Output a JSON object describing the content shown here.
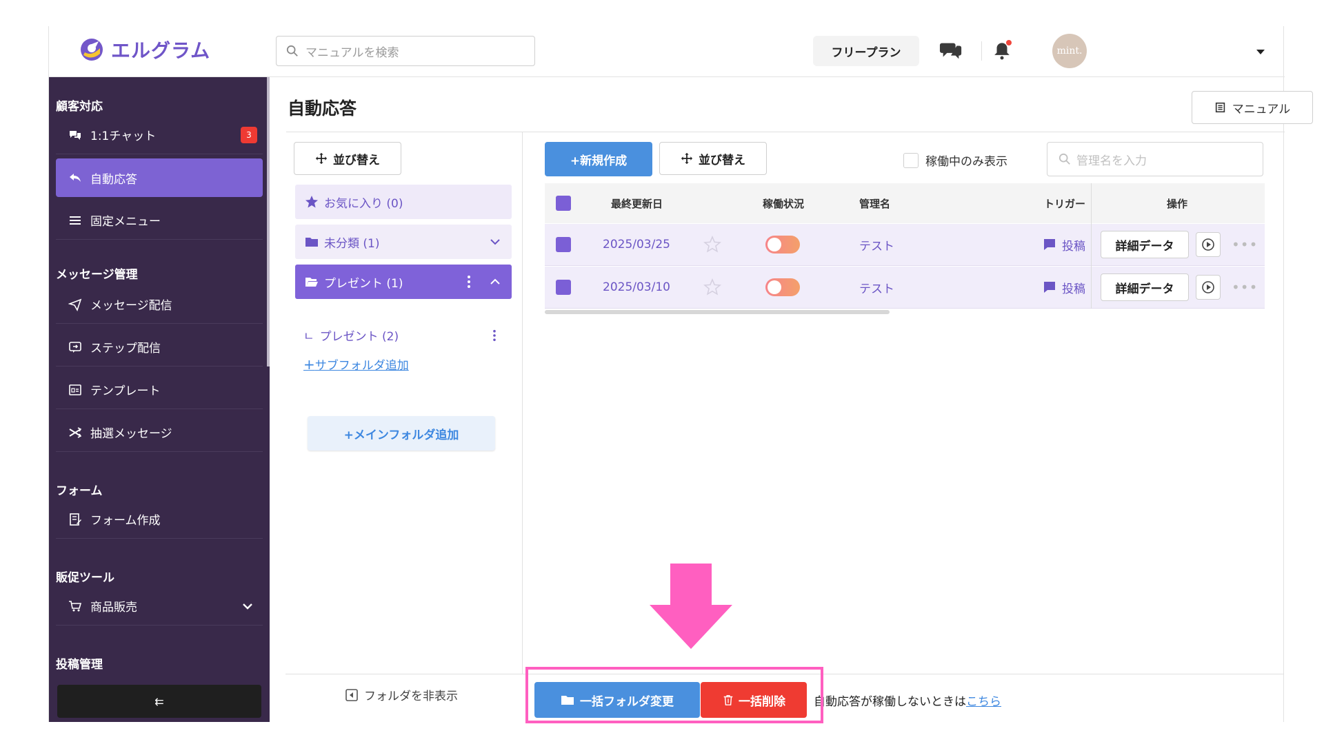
{
  "header": {
    "logo_text": "エルグラム",
    "search_placeholder": "マニュアルを検索",
    "plan_label": "フリープラン",
    "avatar_text": "mint."
  },
  "sidebar": {
    "sections": [
      {
        "title": "顧客対応",
        "items": [
          {
            "label": "1:1チャット",
            "icon": "chat-icon",
            "badge": "3"
          },
          {
            "label": "自動応答",
            "icon": "reply-icon",
            "active": true
          },
          {
            "label": "固定メニュー",
            "icon": "menu-icon"
          }
        ]
      },
      {
        "title": "メッセージ管理",
        "items": [
          {
            "label": "メッセージ配信",
            "icon": "send-icon"
          },
          {
            "label": "ステップ配信",
            "icon": "step-icon"
          },
          {
            "label": "テンプレート",
            "icon": "template-icon"
          },
          {
            "label": "抽選メッセージ",
            "icon": "shuffle-icon"
          }
        ]
      },
      {
        "title": "フォーム",
        "items": [
          {
            "label": "フォーム作成",
            "icon": "form-icon"
          }
        ]
      },
      {
        "title": "販促ツール",
        "items": [
          {
            "label": "商品販売",
            "icon": "cart-icon"
          }
        ]
      },
      {
        "title": "投稿管理",
        "items": []
      }
    ],
    "collapse_label": "⇇"
  },
  "main": {
    "title": "自動応答",
    "manual_label": "マニュアル",
    "folder_sort_label": "並び替え",
    "folders": {
      "favorite": "お気に入り (0)",
      "uncategorized": "未分類 (1)",
      "selected": "プレゼント (1)",
      "sub": "プレゼント (2)",
      "add_sub": "サブフォルダ追加",
      "add_main": "+メインフォルダ追加"
    },
    "new_label": "+新規作成",
    "list_sort_label": "並び替え",
    "active_only_label": "稼働中のみ表示",
    "name_search_placeholder": "管理名を入力",
    "table": {
      "headers": {
        "updated": "最終更新日",
        "status": "稼働状況",
        "name": "管理名",
        "trigger": "トリガー",
        "actions": "操作"
      },
      "rows": [
        {
          "date": "2025/03/25",
          "name": "テスト",
          "trigger": "投稿",
          "detail": "詳細データ"
        },
        {
          "date": "2025/03/10",
          "name": "テスト",
          "trigger": "投稿",
          "detail": "詳細データ"
        }
      ]
    },
    "footer": {
      "hide_folder": "フォルダを非表示",
      "bulk_folder": "一括フォルダ変更",
      "bulk_delete": "一括削除",
      "help_prefix": "自動応答が稼働しないときは",
      "help_link": "こちら"
    }
  },
  "colors": {
    "sidebar_bg": "#39294a",
    "accent_purple": "#7d63d3",
    "primary_blue": "#4a90de",
    "danger_red": "#ef3b32",
    "annotation_pink": "#ff5fc0"
  }
}
